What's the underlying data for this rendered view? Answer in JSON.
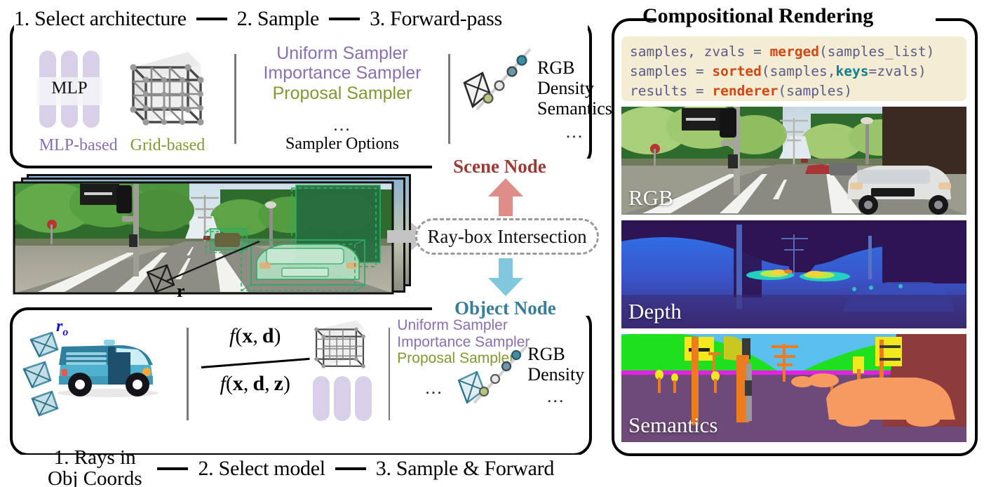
{
  "scene_panel": {
    "steps": [
      "1. Select architecture",
      "2. Sample",
      "3. Forward-pass"
    ],
    "node_label": "Scene Node",
    "node_color": "#9c3b35",
    "architecture": {
      "mlp_icon_text": "MLP",
      "mlp_caption": "MLP-based",
      "grid_caption": "Grid-based",
      "mlp_color": "#8a6fb0",
      "grid_color": "#7f9a33"
    },
    "samplers": {
      "items": [
        "Uniform Sampler",
        "Importance Sampler",
        "Proposal Sampler"
      ],
      "item_colors": [
        "#8a6fb0",
        "#8a6fb0",
        "#7f9a33"
      ],
      "ellipsis": "...",
      "caption": "Sampler Options"
    },
    "outputs": {
      "items": [
        "RGB",
        "Density",
        "Semantics"
      ],
      "ellipsis": "..."
    }
  },
  "scene_strip": {
    "ray_label": "r"
  },
  "middle": {
    "raybox_label": "Ray-box Intersection",
    "up_arrow_color": "#de8d88",
    "down_arrow_color": "#7fc8dd",
    "grey_arrow_color": "#c4c4c4"
  },
  "object_panel": {
    "steps": [
      "1. Rays in Obj Coords",
      "2. Select model",
      "3. Sample & Forward"
    ],
    "steps_flat": [
      "1. Rays in",
      "Obj Coords",
      "2. Select model",
      "3. Sample & Forward"
    ],
    "node_label": "Object Node",
    "node_color": "#3a7d96",
    "ray_origin_label": "r",
    "ray_origin_sub": "o",
    "formula": {
      "numerator": "f(x, d)",
      "denominator": "f(x, d, z)"
    },
    "samplers": {
      "items": [
        "Uniform Sampler",
        "Importance Sampler",
        "Proposal Sampler"
      ],
      "item_colors": [
        "#8a6fb0",
        "#8a6fb0",
        "#7f9a33"
      ],
      "ellipsis": "..."
    },
    "outputs": {
      "items": [
        "RGB",
        "Density"
      ],
      "ellipsis": "..."
    }
  },
  "render_panel": {
    "title": "Compositional Rendering",
    "code": {
      "background": "#f4ecd3",
      "lines": [
        [
          {
            "t": "samples, zvals = ",
            "c": "plain"
          },
          {
            "t": "merged",
            "c": "fn"
          },
          {
            "t": "(samples_list)",
            "c": "plain"
          }
        ],
        [
          {
            "t": "samples = ",
            "c": "plain"
          },
          {
            "t": "sorted",
            "c": "fn"
          },
          {
            "t": "(samples,",
            "c": "plain"
          },
          {
            "t": "keys",
            "c": "kw"
          },
          {
            "t": "=zvals)",
            "c": "plain"
          }
        ],
        [
          {
            "t": "results = ",
            "c": "plain"
          },
          {
            "t": "renderer",
            "c": "fn"
          },
          {
            "t": "(samples)",
            "c": "plain"
          }
        ]
      ],
      "colors": {
        "plain": "#4a4a7a",
        "fn": "#cc4a16",
        "kw": "#117f8c"
      }
    },
    "images": [
      {
        "label": "RGB"
      },
      {
        "label": "Depth"
      },
      {
        "label": "Semantics"
      }
    ]
  }
}
